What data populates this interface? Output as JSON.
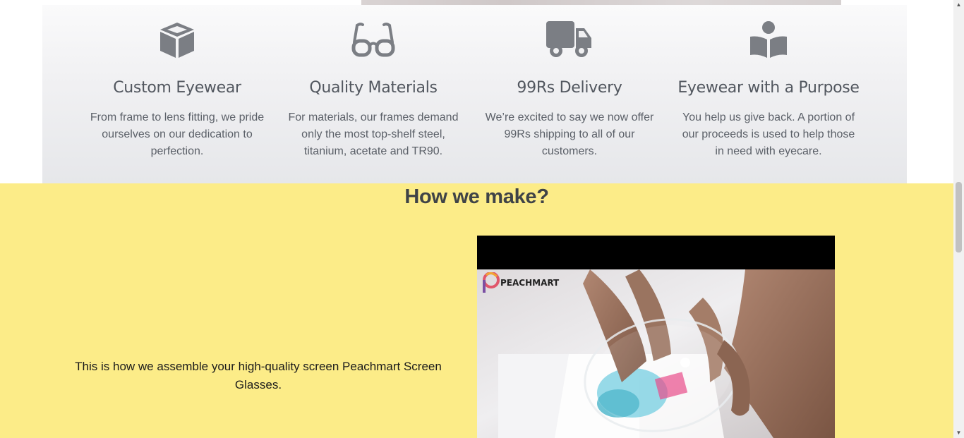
{
  "features": [
    {
      "icon": "box-icon",
      "title": "Custom Eyewear",
      "description": "From frame to lens fitting, we pride ourselves on our dedication to perfection."
    },
    {
      "icon": "glasses-icon",
      "title": "Quality Materials",
      "description": "For materials, our frames demand only the most top-shelf steel, titanium, acetate and TR90."
    },
    {
      "icon": "truck-icon",
      "title": "99Rs Delivery",
      "description": "We’re excited to say we now offer 99Rs shipping to all of our customers."
    },
    {
      "icon": "reader-icon",
      "title": "Eyewear with a Purpose",
      "description": "You help us give back. A portion of our proceeds is used to help those in need with eyecare."
    }
  ],
  "how": {
    "heading": "How we make?",
    "text": "This is how we assemble your high-quality screen Peachmart Screen Glasses.",
    "video": {
      "brand": "PEACHMART"
    }
  },
  "colors": {
    "feature_band": "#eeeff1",
    "icon": "#7b7e84",
    "how_background": "#fcec88",
    "heading": "#3f4347"
  }
}
